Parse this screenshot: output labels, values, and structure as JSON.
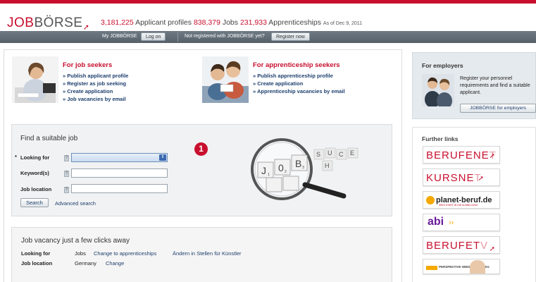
{
  "header": {
    "logo_job": "JOB",
    "logo_rest": "BÖRSE",
    "applicants_count": "3,181,225",
    "applicants_label": "Applicant profiles",
    "jobs_count": "838,379",
    "jobs_label": "Jobs",
    "apprenticeships_count": "231,933",
    "apprenticeships_label": "Apprenticeships",
    "as_of": "As of Dec 9, 2011"
  },
  "navbar": {
    "my_label": "My JOBBÖRSE",
    "login_button": "Log on",
    "not_registered": "Not registered with JOBBÖRSE yet?",
    "register_button": "Register now"
  },
  "job_seekers": {
    "title": "For job seekers",
    "items": [
      "Publish applicant profile",
      "Register as job seeking",
      "Create application",
      "Job vacancies by email"
    ]
  },
  "apprenticeship_seekers": {
    "title": "For apprenticeship seekers",
    "items": [
      "Publish apprenticeship profile",
      "Create application",
      "Apprenticeship vacancies by email"
    ]
  },
  "find_job": {
    "title": "Find a suitable job",
    "looking_for_label": "Looking for",
    "looking_for_marker": "*",
    "keywords_label": "Keyword(s)",
    "location_label": "Job location",
    "search_button": "Search",
    "advanced_search": "Advanced search",
    "hint_glyph": "?",
    "select_arrow": "⇕"
  },
  "annotation": {
    "marker": "1"
  },
  "magnifier": {
    "cubes": [
      "J",
      "0",
      "B",
      "S",
      "U",
      "C",
      "H",
      "E"
    ],
    "subscripts": [
      "1",
      "2",
      "3"
    ]
  },
  "clicks_box": {
    "title": "Job vacancy just a few clicks away",
    "looking_for_label": "Looking for",
    "looking_for_value": "Jobs",
    "change_to_apprenticeships": "Change to apprenticeships",
    "change_artists": "Ändern in Stellen für Künstler",
    "location_label": "Job location",
    "location_value": "Germany",
    "change_location": "Change"
  },
  "employers": {
    "title": "For employers",
    "text": "Register your personnel requirements and find a suitable applicant.",
    "button": "JOBBÖRSE for employers"
  },
  "further_links": {
    "title": "Further links",
    "berufenet_main": "BERUFENE",
    "berufenet_fade": "T",
    "kursnet_main": "KURSNE",
    "kursnet_fade": "T",
    "planet": "planet-beruf.de",
    "planet_sub": "MEIN START IN DIE AUSBILDUNG",
    "abi": "abi",
    "abi_arrows": "››",
    "berufetv_main": "BERUFET",
    "berufetv_fade": "V",
    "perspektive": "PERSPEKTIVE WIEDEREINSTIEG"
  },
  "colors": {
    "brand_red": "#c8102e",
    "link_blue": "#1d3f6e",
    "navbar": "#5f6a74"
  }
}
